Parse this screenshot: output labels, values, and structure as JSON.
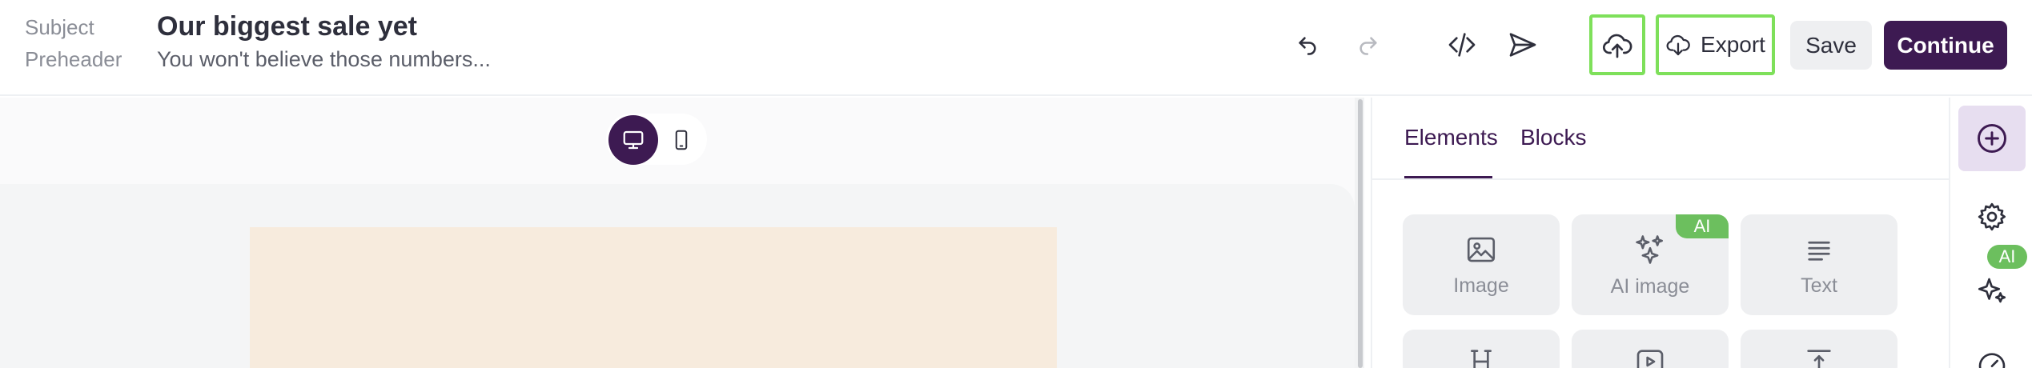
{
  "header": {
    "subject_label": "Subject",
    "subject_value": "Our biggest sale yet",
    "preheader_label": "Preheader",
    "preheader_value": "You won't believe those numbers...",
    "toolbar": {
      "undo_icon": "undo-icon",
      "redo_icon": "redo-icon",
      "code_icon": "code-icon",
      "send_icon": "send-icon",
      "upload_icon": "cloud-upload-icon",
      "export_label": "Export",
      "save_label": "Save",
      "continue_label": "Continue"
    }
  },
  "canvas": {
    "device_modes": [
      "desktop",
      "mobile"
    ],
    "selected_device": "desktop"
  },
  "panel": {
    "tabs": [
      {
        "label": "Elements",
        "active": true
      },
      {
        "label": "Blocks",
        "active": false
      }
    ],
    "elements": [
      {
        "label": "Image",
        "icon": "image-icon"
      },
      {
        "label": "AI image",
        "icon": "sparkles-icon",
        "badge": "AI"
      },
      {
        "label": "Text",
        "icon": "text-lines-icon"
      }
    ]
  },
  "rail": {
    "ai_badge": "AI",
    "items": [
      "add-icon",
      "gear-icon",
      "sparkles-icon",
      "gauge-icon"
    ]
  },
  "colors": {
    "brand": "#3d1a52",
    "highlight": "#7ee05a",
    "ai_badge": "#6cbf5e",
    "email_block": "#f7ebdd"
  }
}
